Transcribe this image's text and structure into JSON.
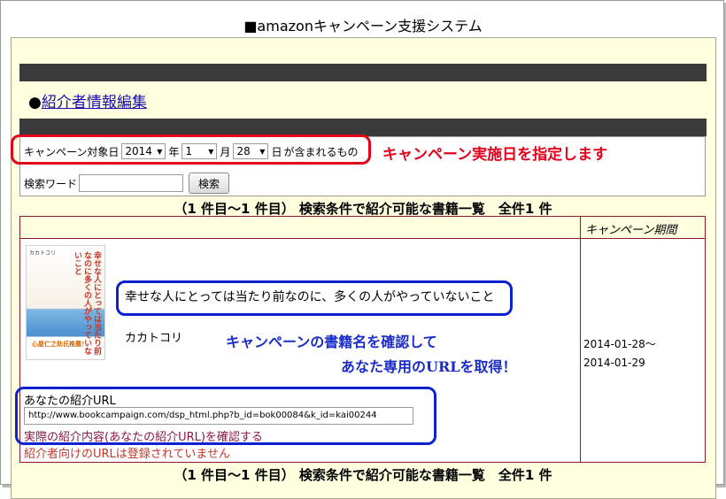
{
  "page": {
    "title": "■amazonキャンペーン支援システム"
  },
  "nav": {
    "bullet": "●",
    "edit_link": "紹介者情報編集"
  },
  "search": {
    "label_date": "キャンペーン対象日",
    "year": "2014",
    "year_suffix": "年",
    "month": "1",
    "month_suffix": "月",
    "day": "28",
    "day_suffix": "日",
    "date_tail": "が含まれるもの",
    "keyword_label": "検索ワード",
    "keyword_value": "",
    "search_button": "検索"
  },
  "annotations": {
    "red_note": "キャンペーン実施日を指定します",
    "blue_note_line1": "キャンペーンの書籍名を確認して",
    "blue_note_line2": "あなた専用のURLを取得！",
    "colors": {
      "red": "#e4001b",
      "blue": "#0a22d0"
    }
  },
  "results": {
    "summary": "（1 件目～1 件目） 検索条件で紹介可能な書籍一覧　全件1 件",
    "table_header": {
      "period": "キャンペーン期間"
    },
    "rows": [
      {
        "title": "幸せな人にとっては当たり前なのに、多くの人がやっていないこと",
        "author": "カカトコリ",
        "url_label": "あなたの紹介URL",
        "url": "http://www.bookcampaign.com/dsp_html.php?b_id=bok00084&k_id=kai00244",
        "confirm_link": "実際の紹介内容(あなたの紹介URL)を確認する",
        "notice": "紹介者向けのURLは登録されていません",
        "period_start": "2014-01-28～",
        "period_end": "2014-01-29",
        "cover": {
          "author": "カカトコリ",
          "title": "幸せな人にとっては当たり前なのに多くの人がやっていないこと",
          "badge": "心屋仁之助氏推薦！"
        }
      }
    ]
  }
}
